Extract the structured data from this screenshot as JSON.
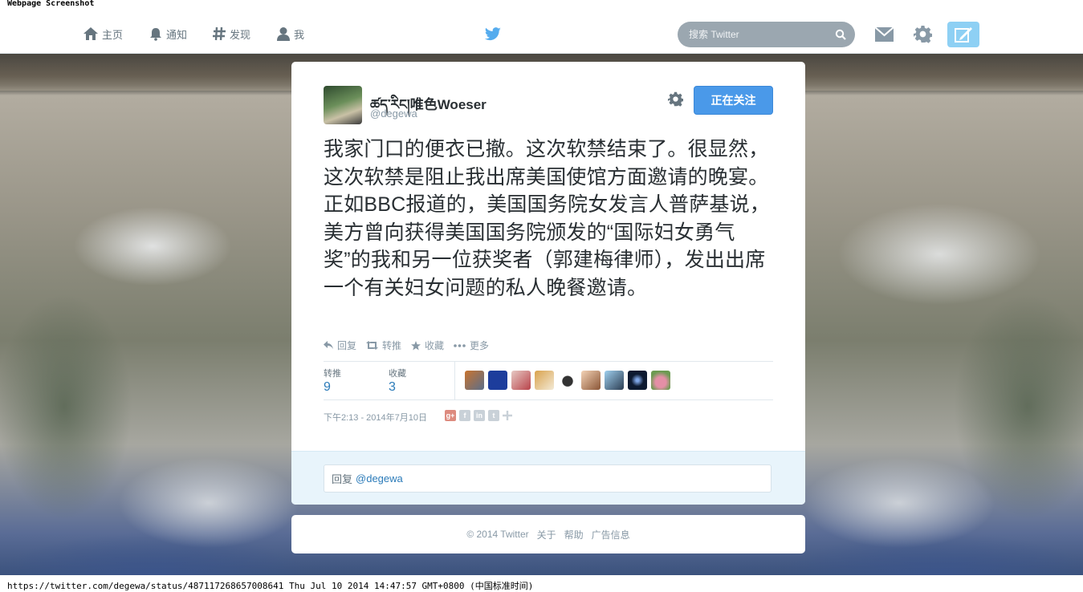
{
  "captions": {
    "top": "Webpage Screenshot",
    "bottom": "https://twitter.com/degewa/status/487117268657008641 Thu Jul 10 2014 14:47:57 GMT+0800 (中国标准时间)"
  },
  "nav": {
    "home": "主页",
    "notifications": "通知",
    "discover": "发现",
    "me": "我",
    "search_placeholder": "搜索 Twitter"
  },
  "tweet": {
    "fullname": "ཚད་རིང།唯色Woeser",
    "username": "@degewa",
    "follow_label": "正在关注",
    "text": "我家门口的便衣已撤。这次软禁结束了。很显然，这次软禁是阻止我出席美国使馆方面邀请的晚宴。正如BBC报道的，美国国务院女发言人普萨基说，美方曾向获得美国国务院颁发的“国际妇女勇气奖”的我和另一位获奖者（郭建梅律师），发出出席一个有关妇女问题的私人晚餐邀请。",
    "actions": {
      "reply": "回复",
      "retweet": "转推",
      "favorite": "收藏",
      "more": "更多"
    },
    "stats": {
      "retweets_label": "转推",
      "retweets": "9",
      "favorites_label": "收藏",
      "favorites": "3"
    },
    "timestamp": "下午2:13 - 2014年7月10日",
    "reply_prefix": "回复",
    "reply_mention": "@degewa"
  },
  "footer": {
    "copyright": "© 2014 Twitter",
    "about": "关于",
    "help": "帮助",
    "ads": "广告信息"
  },
  "colors": {
    "accent": "#4a99e9",
    "link": "#2b7bb9",
    "muted": "#8899a6"
  }
}
